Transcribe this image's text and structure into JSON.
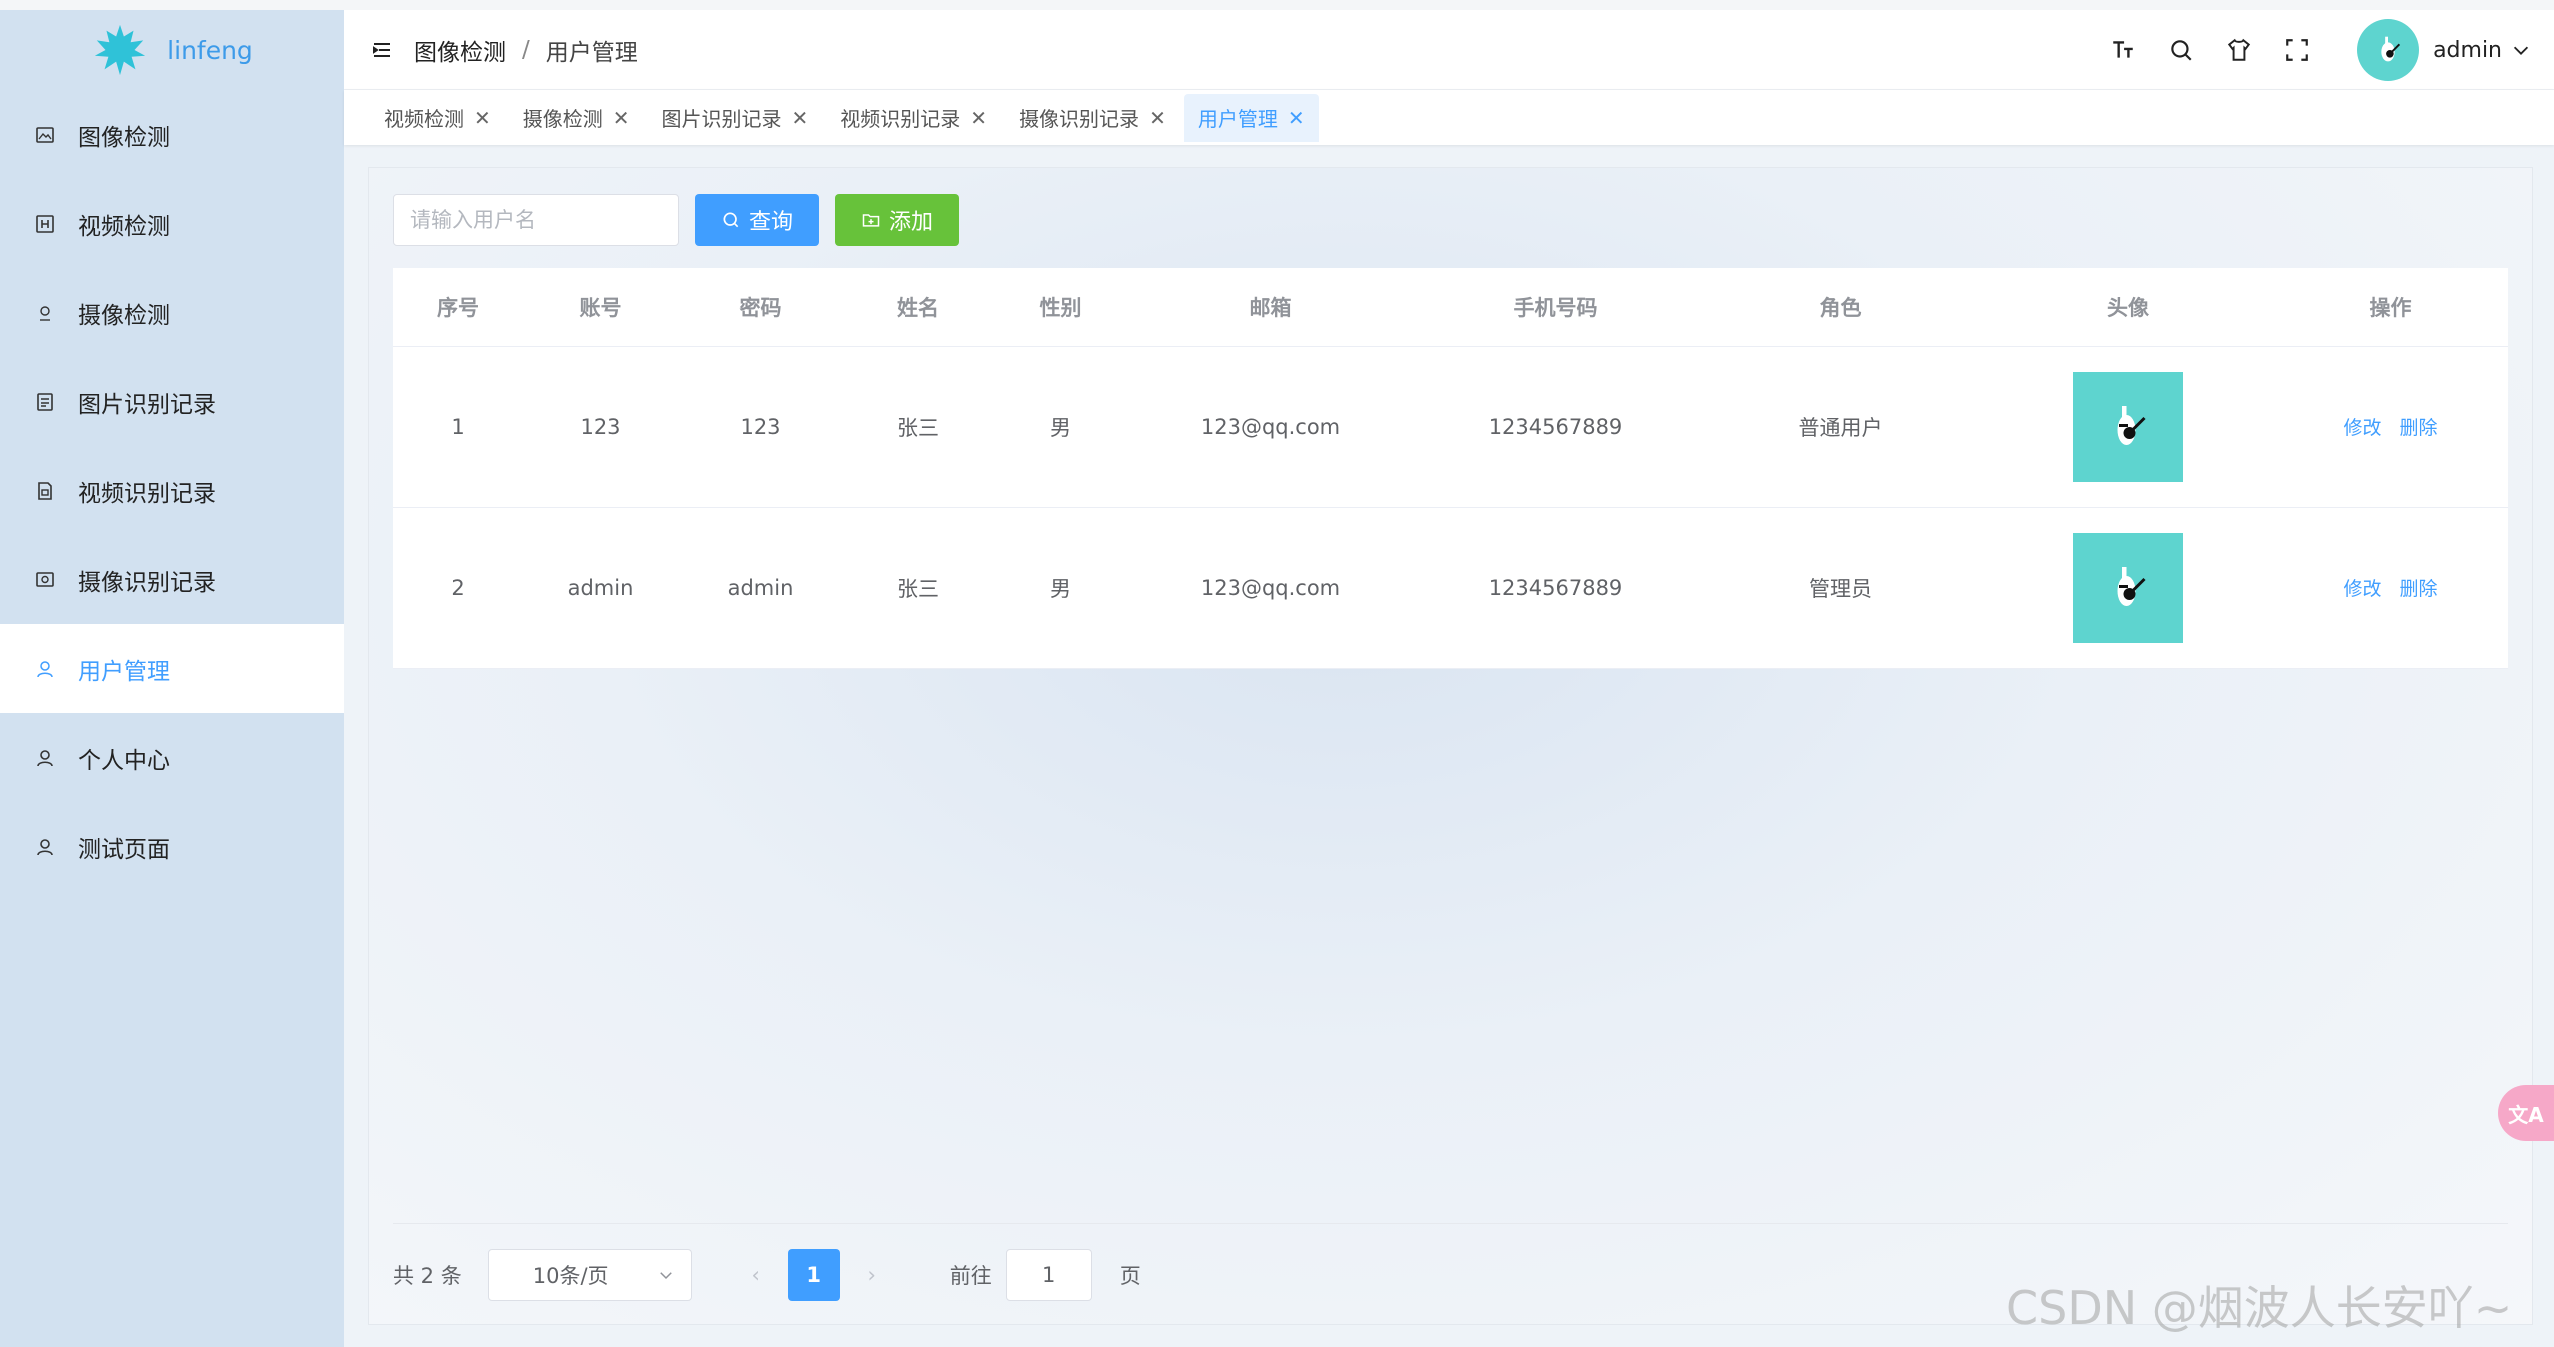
{
  "app": {
    "name": "linfeng"
  },
  "sidebar": {
    "items": [
      {
        "label": "图像检测",
        "icon": "picture-icon"
      },
      {
        "label": "视频检测",
        "icon": "video-icon"
      },
      {
        "label": "摄像检测",
        "icon": "camera-icon"
      },
      {
        "label": "图片识别记录",
        "icon": "document-icon"
      },
      {
        "label": "视频识别记录",
        "icon": "file-icon"
      },
      {
        "label": "摄像识别记录",
        "icon": "screen-icon"
      },
      {
        "label": "用户管理",
        "icon": "user-icon",
        "active": true
      },
      {
        "label": "个人中心",
        "icon": "user-icon"
      },
      {
        "label": "测试页面",
        "icon": "user-icon"
      }
    ]
  },
  "header": {
    "breadcrumb": {
      "first": "图像检测",
      "separator": "/",
      "last": "用户管理"
    },
    "user": "admin"
  },
  "tabs": [
    {
      "label": "视频检测"
    },
    {
      "label": "摄像检测"
    },
    {
      "label": "图片识别记录"
    },
    {
      "label": "视频识别记录"
    },
    {
      "label": "摄像识别记录"
    },
    {
      "label": "用户管理",
      "active": true
    }
  ],
  "toolbar": {
    "search_placeholder": "请输入用户名",
    "query_label": "查询",
    "add_label": "添加"
  },
  "table": {
    "columns": [
      "序号",
      "账号",
      "密码",
      "姓名",
      "性别",
      "邮箱",
      "手机号码",
      "角色",
      "头像",
      "操作"
    ],
    "rows": [
      {
        "index": "1",
        "account": "123",
        "password": "123",
        "name": "张三",
        "gender": "男",
        "email": "123@qq.com",
        "phone": "1234567889",
        "role": "普通用户"
      },
      {
        "index": "2",
        "account": "admin",
        "password": "admin",
        "name": "张三",
        "gender": "男",
        "email": "123@qq.com",
        "phone": "1234567889",
        "role": "管理员"
      }
    ],
    "edit_label": "修改",
    "delete_label": "删除"
  },
  "pagination": {
    "total": "共 2 条",
    "page_size": "10条/页",
    "current_page": "1",
    "goto_label": "前往",
    "goto_value": "1",
    "page_suffix": "页"
  },
  "watermark": "CSDN @烟波人长安吖~",
  "colors": {
    "primary": "#409eff",
    "success": "#67c23a",
    "sidebar": "#d2e1f0",
    "avatar_bg": "#5ed4cf"
  }
}
